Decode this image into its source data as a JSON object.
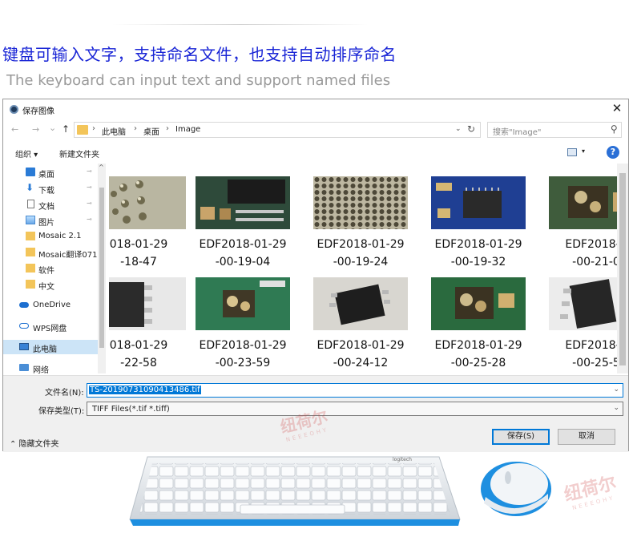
{
  "headline": {
    "cn": "键盘可输入文字，支持命名文件，也支持自动排序命名",
    "en": "The keyboard can input text and support named files"
  },
  "dialog": {
    "title": "保存图像",
    "close_glyph": "✕",
    "nav": {
      "back": "←",
      "forward": "→",
      "recent": "⌄",
      "up": "↑"
    },
    "breadcrumb": [
      "此电脑",
      "桌面",
      "Image"
    ],
    "breadcrumb_sep": "›",
    "address_dropdown": "⌄",
    "refresh": "↻",
    "search_placeholder": "搜索\"Image\"",
    "toolbar": {
      "organize": "组织 ▾",
      "new_folder": "新建文件夹",
      "view_dropdown": "▾",
      "help": "?"
    },
    "sidebar": {
      "items": [
        {
          "label": "桌面",
          "icon": "desktop-icon",
          "pinned": true
        },
        {
          "label": "下载",
          "icon": "download-icon",
          "pinned": true
        },
        {
          "label": "文档",
          "icon": "document-icon",
          "pinned": true
        },
        {
          "label": "图片",
          "icon": "picture-icon",
          "pinned": true
        },
        {
          "label": "Mosaic 2.1",
          "icon": "folder-icon",
          "pinned": false
        },
        {
          "label": "Mosaic翻译071",
          "icon": "folder-icon",
          "pinned": false
        },
        {
          "label": "软件",
          "icon": "folder-icon",
          "pinned": false
        },
        {
          "label": "中文",
          "icon": "folder-icon",
          "pinned": false
        },
        {
          "label": "OneDrive",
          "icon": "cloud-icon",
          "pinned": false
        },
        {
          "label": "WPS网盘",
          "icon": "cloud-icon",
          "pinned": false
        },
        {
          "label": "此电脑",
          "icon": "computer-icon",
          "pinned": false,
          "selected": true
        },
        {
          "label": "网络",
          "icon": "network-icon",
          "pinned": false
        }
      ],
      "pin_glyph": "📌",
      "scroll_up": "^"
    },
    "files": [
      {
        "line1": "018-01-29",
        "line2": "-18-47"
      },
      {
        "line1": "EDF2018-01-29",
        "line2": "-00-19-04"
      },
      {
        "line1": "EDF2018-01-29",
        "line2": "-00-19-24"
      },
      {
        "line1": "EDF2018-01-29",
        "line2": "-00-19-32"
      },
      {
        "line1": "EDF2018-0",
        "line2": "-00-21-0"
      },
      {
        "line1": "018-01-29",
        "line2": "-22-58"
      },
      {
        "line1": "EDF2018-01-29",
        "line2": "-00-23-59"
      },
      {
        "line1": "EDF2018-01-29",
        "line2": "-00-24-12"
      },
      {
        "line1": "EDF2018-01-29",
        "line2": "-00-25-28"
      },
      {
        "line1": "EDF2018-0",
        "line2": "-00-25-5"
      }
    ],
    "filename_label": "文件名(N):",
    "filename_value": "TS-20190731090413486.tif",
    "filetype_label": "保存类型(T):",
    "filetype_value": "TIFF Files(*.tif *.tiff)",
    "dropdown_glyph": "⌄",
    "hide_folders": "⌃ 隐藏文件夹",
    "save_button": "保存(S)",
    "cancel_button": "取消"
  },
  "watermarks": [
    {
      "cn": "纽荷尔",
      "en": "NEEEOHY"
    },
    {
      "cn": "纽荷尔",
      "en": "NEEEOHY"
    }
  ],
  "keyboard_brand": "logitech",
  "colors": {
    "headline_blue": "#1a26d6",
    "accent": "#0078d7",
    "mouse_blue": "#1e8fe0",
    "watermark_red": "#cd3c3c"
  }
}
